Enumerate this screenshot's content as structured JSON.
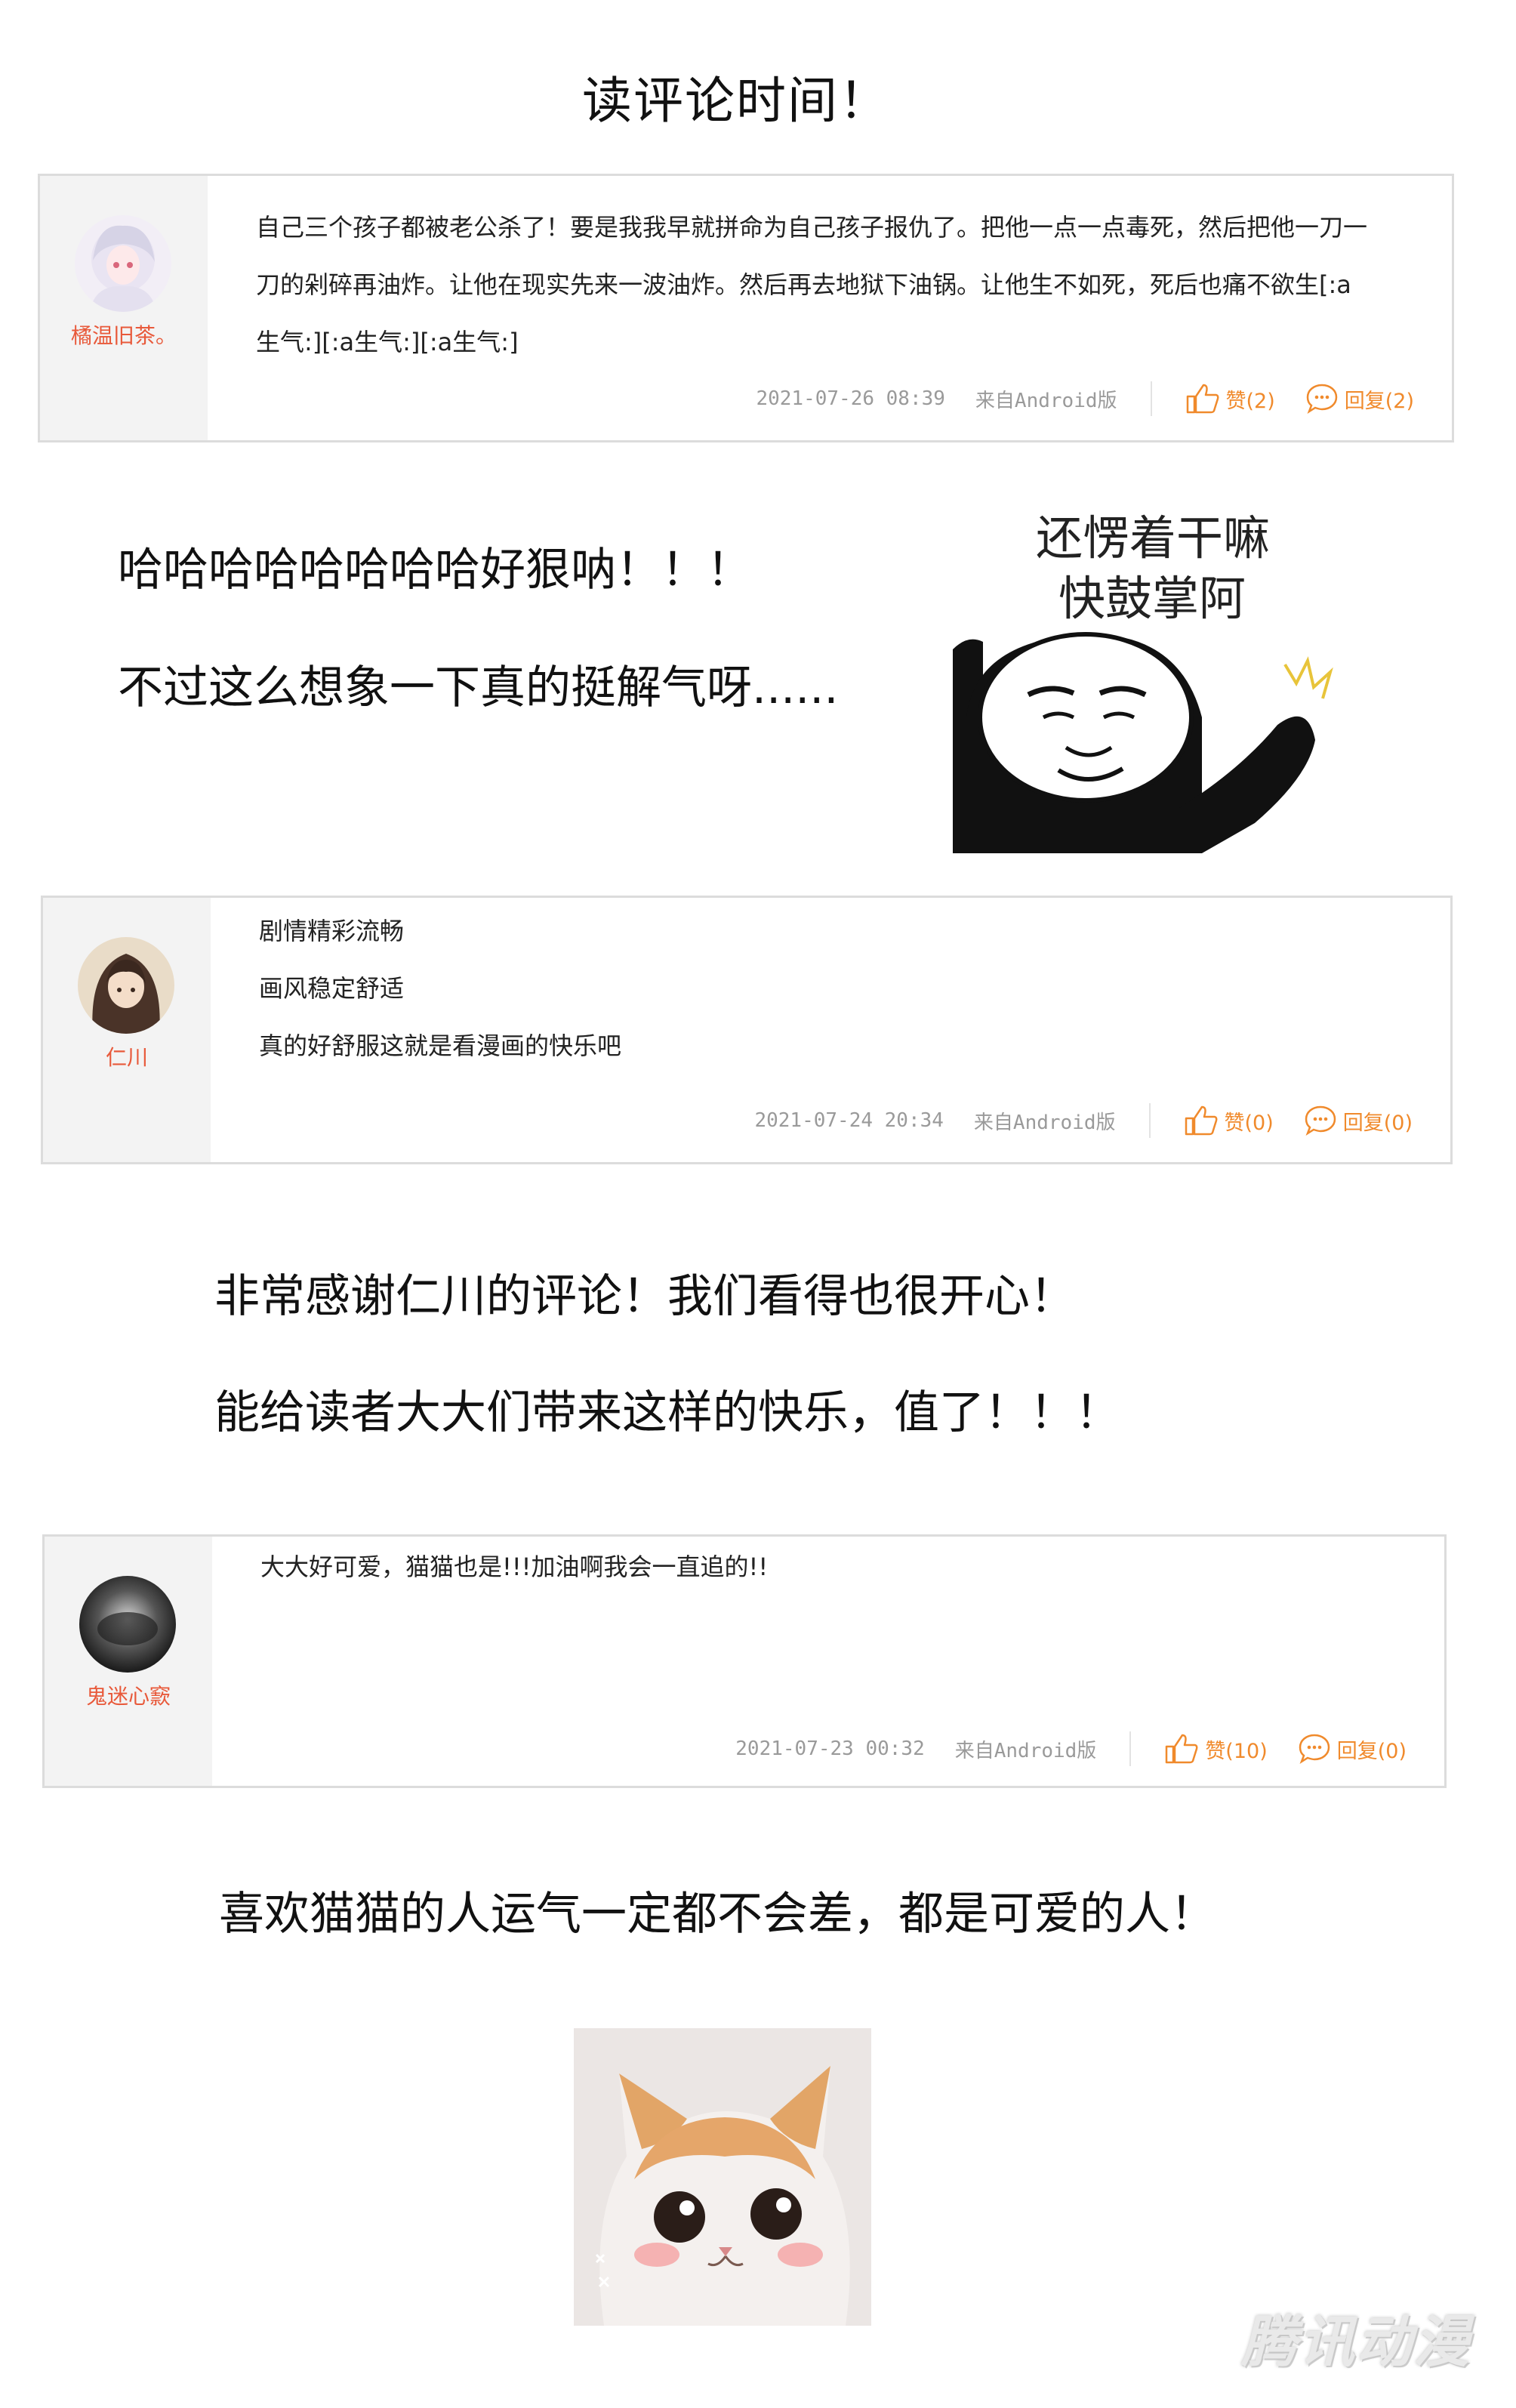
{
  "title": "读评论时间！",
  "comments": [
    {
      "username": "橘温旧茶。",
      "lines": [
        "自己三个孩子都被老公杀了！要是我我早就拼命为自己孩子报仇了。把他一点一点毒死，然后把他一刀一",
        "刀的剁碎再油炸。让他在现实先来一波油炸。然后再去地狱下油锅。让他生不如死，死后也痛不欲生[:a",
        "生气:][:a生气:][:a生气:]"
      ],
      "time": "2021-07-26 08:39",
      "source": "来自Android版",
      "like": "赞(2)",
      "reply": "回复(2)"
    },
    {
      "username": "仁川",
      "lines": [
        "剧情精彩流畅",
        "画风稳定舒适",
        "真的好舒服这就是看漫画的快乐吧"
      ],
      "time": "2021-07-24 20:34",
      "source": "来自Android版",
      "like": "赞(0)",
      "reply": "回复(0)"
    },
    {
      "username": "鬼迷心窾",
      "lines": [
        "大大好可爱，猫猫也是!!!加油啊我会一直追的!!"
      ],
      "time": "2021-07-23 00:32",
      "source": "来自Android版",
      "like": "赞(10)",
      "reply": "回复(0)"
    }
  ],
  "responses": {
    "r1_line1": "哈哈哈哈哈哈哈哈好狠呐！！！",
    "r1_line2": "不过这么想象一下真的挺解气呀......",
    "r2_line1": "非常感谢仁川的评论！我们看得也很开心！",
    "r2_line2": "能给读者大大们带来这样的快乐，值了！！！",
    "r3_line1": "喜欢猫猫的人运气一定都不会差，都是可爱的人！"
  },
  "sticker_panda": {
    "line1": "还愣着干嘛",
    "line2": "快鼓掌阿"
  },
  "watermark": "腾讯动漫"
}
